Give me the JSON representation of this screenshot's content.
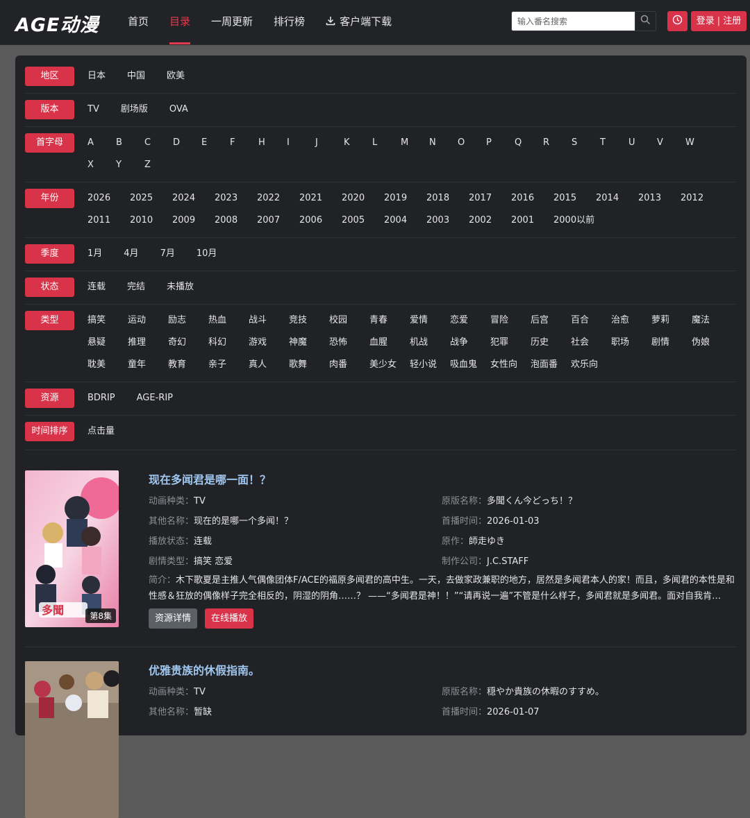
{
  "header": {
    "logo": "AGE动漫",
    "nav": [
      {
        "label": "首页",
        "active": false
      },
      {
        "label": "目录",
        "active": true
      },
      {
        "label": "一周更新",
        "active": false
      },
      {
        "label": "排行榜",
        "active": false
      },
      {
        "label": "客户端下载",
        "active": false
      }
    ],
    "search_placeholder": "输入番名搜索",
    "login": "登录",
    "register": "注册"
  },
  "filters": {
    "region": {
      "label": "地区",
      "options": [
        "日本",
        "中国",
        "欧美"
      ]
    },
    "version": {
      "label": "版本",
      "options": [
        "TV",
        "剧场版",
        "OVA"
      ]
    },
    "letter": {
      "label": "首字母",
      "options": [
        "A",
        "B",
        "C",
        "D",
        "E",
        "F",
        "H",
        "I",
        "J",
        "K",
        "L",
        "M",
        "N",
        "O",
        "P",
        "Q",
        "R",
        "S",
        "T",
        "U",
        "V",
        "W",
        "X",
        "Y",
        "Z"
      ]
    },
    "year": {
      "label": "年份",
      "options": [
        "2026",
        "2025",
        "2024",
        "2023",
        "2022",
        "2021",
        "2020",
        "2019",
        "2018",
        "2017",
        "2016",
        "2015",
        "2014",
        "2013",
        "2012",
        "2011",
        "2010",
        "2009",
        "2008",
        "2007",
        "2006",
        "2005",
        "2004",
        "2003",
        "2002",
        "2001",
        "2000以前"
      ]
    },
    "season": {
      "label": "季度",
      "options": [
        "1月",
        "4月",
        "7月",
        "10月"
      ]
    },
    "status": {
      "label": "状态",
      "options": [
        "连载",
        "完结",
        "未播放"
      ]
    },
    "genre": {
      "label": "类型",
      "options": [
        "搞笑",
        "运动",
        "励志",
        "热血",
        "战斗",
        "竞技",
        "校园",
        "青春",
        "爱情",
        "恋爱",
        "冒险",
        "后宫",
        "百合",
        "治愈",
        "萝莉",
        "魔法",
        "悬疑",
        "推理",
        "奇幻",
        "科幻",
        "游戏",
        "神魔",
        "恐怖",
        "血腥",
        "机战",
        "战争",
        "犯罪",
        "历史",
        "社会",
        "职场",
        "剧情",
        "伪娘",
        "耽美",
        "童年",
        "教育",
        "亲子",
        "真人",
        "歌舞",
        "肉番",
        "美少女",
        "轻小说",
        "吸血鬼",
        "女性向",
        "泡面番",
        "欢乐向"
      ]
    },
    "resource": {
      "label": "资源",
      "options": [
        "BDRIP",
        "AGE-RIP"
      ]
    },
    "sort": {
      "label": "时间排序",
      "options": [
        "点击量"
      ]
    }
  },
  "anime": [
    {
      "title": "现在多闻君是哪一面！？",
      "episode_badge": "第8集",
      "type_label": "动画种类：",
      "type": "TV",
      "orig_label": "原版名称：",
      "orig": "多聞くん今どっち！？",
      "alias_label": "其他名称：",
      "alias": "现在的是哪一个多闻！？",
      "premiere_label": "首播时间：",
      "premiere": "2026-01-03",
      "status_label": "播放状态：",
      "status": "连载",
      "author_label": "原作：",
      "author": "師走ゆき",
      "genre_label": "剧情类型：",
      "genre": "搞笑 恋爱",
      "studio_label": "制作公司：",
      "studio": "J.C.STAFF",
      "desc_label": "简介：",
      "desc": "木下歌夏是主推人气偶像团体F/ACE的福原多闻君的高中生。一天，去做家政兼职的地方，居然是多闻君本人的家！而且，多闻君的本性是和性感＆狂放的偶像样子完全相反的，阴湿的阴角……？ ——“多闻君是神！！”“请再说一遍”不管是什么样子，多闻君就是多闻君。面对自我肯…",
      "detail_btn": "资源详情",
      "play_btn": "在线播放"
    },
    {
      "title": "优雅贵族的休假指南。",
      "type_label": "动画种类：",
      "type": "TV",
      "orig_label": "原版名称：",
      "orig": "穏やか貴族の休暇のすすめ。",
      "alias_label": "其他名称：",
      "alias": "暂缺",
      "premiere_label": "首播时间：",
      "premiere": "2026-01-07"
    }
  ],
  "colors": {
    "accent": "#d9334a",
    "title_link": "#9fc6ee",
    "card_bg": "#202225"
  }
}
